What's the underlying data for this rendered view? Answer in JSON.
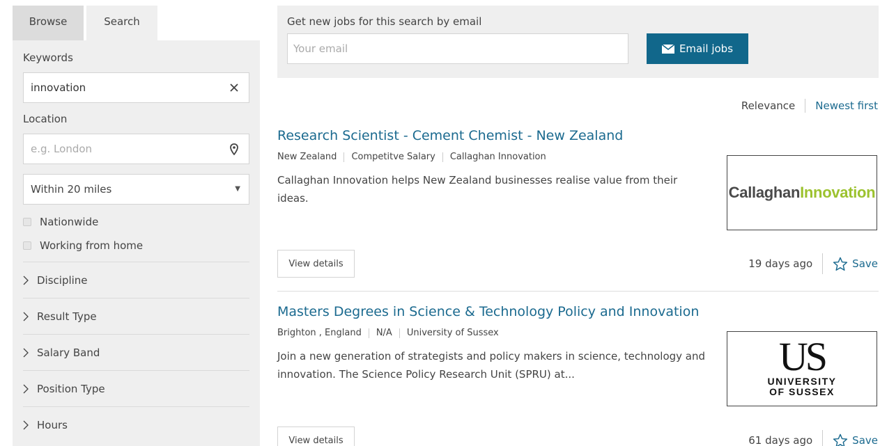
{
  "sidebar": {
    "tabs": [
      "Browse",
      "Search"
    ],
    "keywords_label": "Keywords",
    "keywords_value": "innovation",
    "location_label": "Location",
    "location_placeholder": "e.g. London",
    "radius_selected": "Within 20 miles",
    "checkboxes": [
      "Nationwide",
      "Working from home"
    ],
    "filters": [
      "Discipline",
      "Result Type",
      "Salary Band",
      "Position Type",
      "Hours"
    ]
  },
  "alert": {
    "title": "Get new jobs for this search by email",
    "email_placeholder": "Your email",
    "button_label": "Email jobs"
  },
  "sort": {
    "relevance": "Relevance",
    "newest": "Newest first"
  },
  "jobs": [
    {
      "title": "Research Scientist - Cement Chemist - New Zealand",
      "location": "New Zealand",
      "salary": "Competitve Salary",
      "employer": "Callaghan Innovation",
      "description": "Callaghan Innovation helps New Zealand businesses realise value from their ideas.",
      "logo_part1": "Callaghan",
      "logo_part2": "Innovation",
      "details_label": "View details",
      "posted": "19 days ago",
      "save_label": "Save"
    },
    {
      "title": "Masters Degrees in Science & Technology Policy and Innovation",
      "location": "Brighton , England",
      "salary": "N/A",
      "employer": "University of Sussex",
      "description": "Join a new generation of strategists and policy makers in science, technology and innovation.  The Science Policy Research Unit (SPRU) at...",
      "logo_line1": "US",
      "logo_line2": "UNIVERSITY",
      "logo_line3": "OF SUSSEX",
      "details_label": "View details",
      "posted": "61 days ago",
      "save_label": "Save"
    }
  ],
  "colors": {
    "link": "#1b6a8f",
    "button": "#11678b",
    "panel_bg": "#efefef",
    "logo_green": "#9cc22f"
  },
  "icons": [
    "clear-icon",
    "location-pin-icon",
    "dropdown-caret-icon",
    "chevron-right-icon",
    "envelope-icon",
    "star-outline-icon"
  ]
}
